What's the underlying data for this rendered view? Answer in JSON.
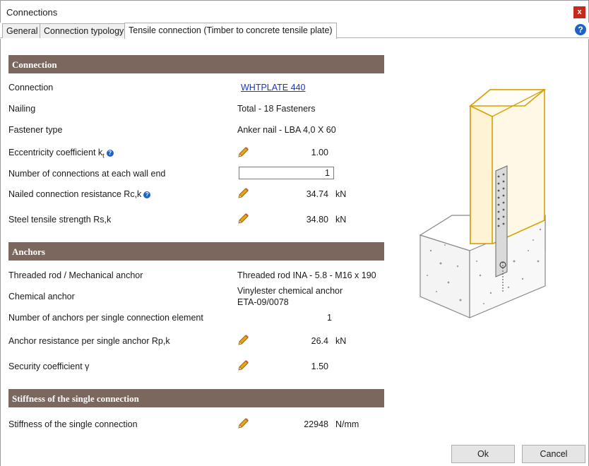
{
  "window": {
    "title": "Connections",
    "close_label": "x"
  },
  "tabs": [
    {
      "label": "General"
    },
    {
      "label": "Connection typology"
    },
    {
      "label": "Tensile connection (Timber to concrete tensile plate)"
    }
  ],
  "help_icon": "?",
  "sections": {
    "connection": {
      "title": "Connection",
      "rows": {
        "connection": {
          "label": "Connection",
          "value": "WHTPLATE 440"
        },
        "nailing": {
          "label": "Nailing",
          "value": "Total - 18 Fasteners"
        },
        "fastener_type": {
          "label": "Fastener type",
          "value": "Anker nail - LBA 4,0 X 60"
        },
        "eccentricity": {
          "label": "Eccentricity coefficient  k",
          "subscript": "t",
          "value": "1.00"
        },
        "connections_per_wall_end": {
          "label": "Number of connections at each wall end",
          "value": "1"
        },
        "nailed_resistance": {
          "label": "Nailed connection resistance  Rc,k",
          "value": "34.74",
          "unit": "kN"
        },
        "steel_strength": {
          "label": "Steel tensile strength Rs,k",
          "value": "34.80",
          "unit": "kN"
        }
      }
    },
    "anchors": {
      "title": "Anchors",
      "rows": {
        "threaded_rod": {
          "label": "Threaded rod / Mechanical anchor",
          "value": "Threaded rod INA - 5.8 - M16 x 190"
        },
        "chemical_anchor": {
          "label": "Chemical anchor",
          "value_line1": "Vinylester chemical anchor",
          "value_line2": "ETA-09/0078"
        },
        "anchors_per_element": {
          "label": "Number of anchors per single connection element",
          "value": "1"
        },
        "anchor_resistance": {
          "label": "Anchor resistance per single anchor Rp,k",
          "value": "26.4",
          "unit": "kN"
        },
        "security_coefficient": {
          "label": "Security coefficient γ",
          "value": "1.50"
        }
      }
    },
    "stiffness": {
      "title": "Stiffness of the single connection",
      "rows": {
        "stiffness": {
          "label": "Stiffness of the single connection",
          "value": "22948",
          "unit": "N/mm"
        }
      }
    }
  },
  "icons": {
    "edit": "pencil-icon",
    "info": "info-icon"
  },
  "colors": {
    "section_header": "#7b675d",
    "link": "#1a33cc",
    "close": "#c42b1c",
    "info": "#1e63c4",
    "timber_edge": "#d7a000"
  },
  "buttons": {
    "ok": "Ok",
    "cancel": "Cancel"
  }
}
